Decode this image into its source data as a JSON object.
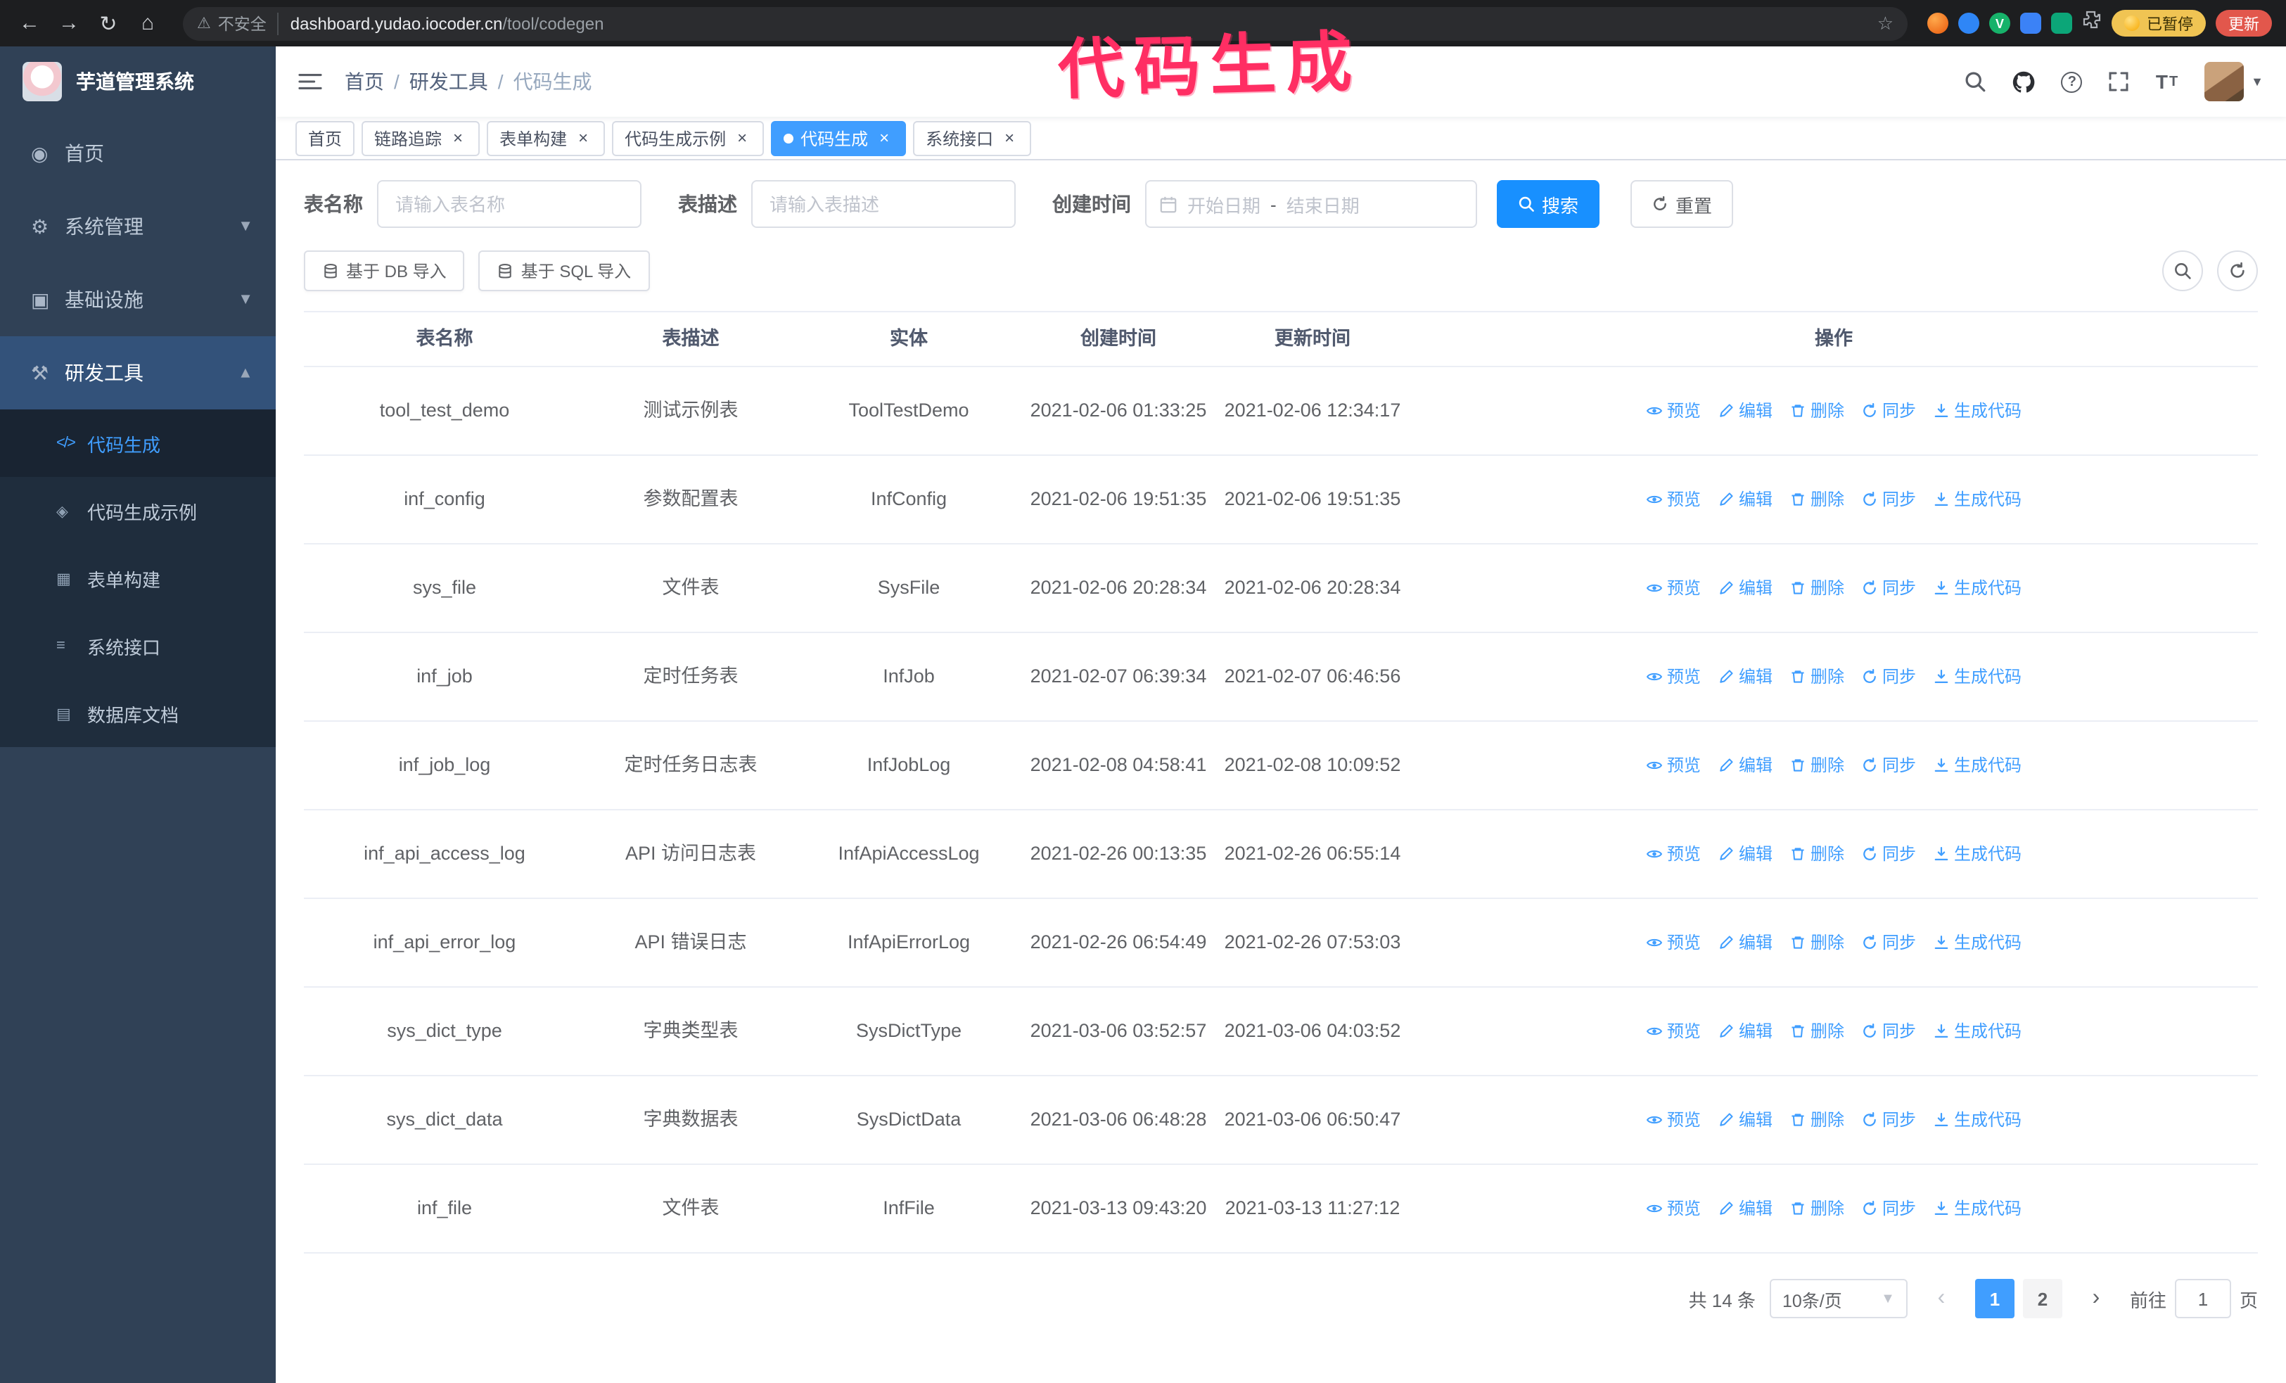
{
  "annotation": {
    "text": "代码生成",
    "color": "#ff2e63"
  },
  "browser": {
    "security_label": "不安全",
    "url_host": "dashboard.yudao.iocoder.cn",
    "url_path": "/tool/codegen",
    "paused_badge": "已暂停",
    "update_button": "更新"
  },
  "icons": {
    "dashboard": "◉",
    "gear": "⚙",
    "monitor": "▣",
    "tool": "⚒",
    "code": "</>",
    "badge": "◈",
    "form": "▦",
    "api": "≡",
    "doc": "▤"
  },
  "sidebar": {
    "logo_title": "芋道管理系统",
    "items": [
      {
        "key": "home",
        "label": "首页",
        "icon": "dashboard",
        "expandable": false,
        "expanded": false
      },
      {
        "key": "system",
        "label": "系统管理",
        "icon": "gear",
        "expandable": true,
        "expanded": false
      },
      {
        "key": "infra",
        "label": "基础设施",
        "icon": "monitor",
        "expandable": true,
        "expanded": false
      },
      {
        "key": "devtools",
        "label": "研发工具",
        "icon": "tool",
        "expandable": true,
        "expanded": true
      }
    ],
    "subitems": [
      {
        "key": "codegen",
        "label": "代码生成",
        "icon": "code",
        "active": true
      },
      {
        "key": "codegen-example",
        "label": "代码生成示例",
        "icon": "badge",
        "active": false
      },
      {
        "key": "form-builder",
        "label": "表单构建",
        "icon": "form",
        "active": false
      },
      {
        "key": "system-api",
        "label": "系统接口",
        "icon": "api",
        "active": false
      },
      {
        "key": "db-doc",
        "label": "数据库文档",
        "icon": "doc",
        "active": false
      }
    ]
  },
  "header": {
    "breadcrumb": [
      "首页",
      "研发工具",
      "代码生成"
    ]
  },
  "tabs": [
    {
      "key": "home",
      "label": "首页",
      "closable": false,
      "active": false
    },
    {
      "key": "trace",
      "label": "链路追踪",
      "closable": true,
      "active": false
    },
    {
      "key": "form-builder",
      "label": "表单构建",
      "closable": true,
      "active": false
    },
    {
      "key": "codegen-example",
      "label": "代码生成示例",
      "closable": true,
      "active": false
    },
    {
      "key": "codegen",
      "label": "代码生成",
      "closable": true,
      "active": true
    },
    {
      "key": "system-api",
      "label": "系统接口",
      "closable": true,
      "active": false
    }
  ],
  "filters": {
    "table_name_label": "表名称",
    "table_name_placeholder": "请输入表名称",
    "table_desc_label": "表描述",
    "table_desc_placeholder": "请输入表描述",
    "create_time_label": "创建时间",
    "date_start_placeholder": "开始日期",
    "date_separator": "-",
    "date_end_placeholder": "结束日期",
    "search_button": "搜索",
    "reset_button": "重置"
  },
  "toolbar": {
    "import_db": "基于 DB 导入",
    "import_sql": "基于 SQL 导入"
  },
  "table": {
    "columns": [
      "表名称",
      "表描述",
      "实体",
      "创建时间",
      "更新时间",
      "操作"
    ],
    "actions": [
      "预览",
      "编辑",
      "删除",
      "同步",
      "生成代码"
    ],
    "rows": [
      {
        "name": "tool_test_demo",
        "desc": "测试示例表",
        "entity": "ToolTestDemo",
        "created": "2021-02-06 01:33:25",
        "updated": "2021-02-06 12:34:17"
      },
      {
        "name": "inf_config",
        "desc": "参数配置表",
        "entity": "InfConfig",
        "created": "2021-02-06 19:51:35",
        "updated": "2021-02-06 19:51:35"
      },
      {
        "name": "sys_file",
        "desc": "文件表",
        "entity": "SysFile",
        "created": "2021-02-06 20:28:34",
        "updated": "2021-02-06 20:28:34"
      },
      {
        "name": "inf_job",
        "desc": "定时任务表",
        "entity": "InfJob",
        "created": "2021-02-07 06:39:34",
        "updated": "2021-02-07 06:46:56"
      },
      {
        "name": "inf_job_log",
        "desc": "定时任务日志表",
        "entity": "InfJobLog",
        "created": "2021-02-08 04:58:41",
        "updated": "2021-02-08 10:09:52"
      },
      {
        "name": "inf_api_access_log",
        "desc": "API 访问日志表",
        "entity": "InfApiAccessLog",
        "created": "2021-02-26 00:13:35",
        "updated": "2021-02-26 06:55:14"
      },
      {
        "name": "inf_api_error_log",
        "desc": "API 错误日志",
        "entity": "InfApiErrorLog",
        "created": "2021-02-26 06:54:49",
        "updated": "2021-02-26 07:53:03"
      },
      {
        "name": "sys_dict_type",
        "desc": "字典类型表",
        "entity": "SysDictType",
        "created": "2021-03-06 03:52:57",
        "updated": "2021-03-06 04:03:52"
      },
      {
        "name": "sys_dict_data",
        "desc": "字典数据表",
        "entity": "SysDictData",
        "created": "2021-03-06 06:48:28",
        "updated": "2021-03-06 06:50:47"
      },
      {
        "name": "inf_file",
        "desc": "文件表",
        "entity": "InfFile",
        "created": "2021-03-13 09:43:20",
        "updated": "2021-03-13 11:27:12"
      }
    ]
  },
  "pagination": {
    "total": "共 14 条",
    "page_size": "10条/页",
    "pages": [
      "1",
      "2"
    ],
    "active_page": "1",
    "goto_label": "前往",
    "goto_value": "1",
    "goto_suffix": "页"
  }
}
